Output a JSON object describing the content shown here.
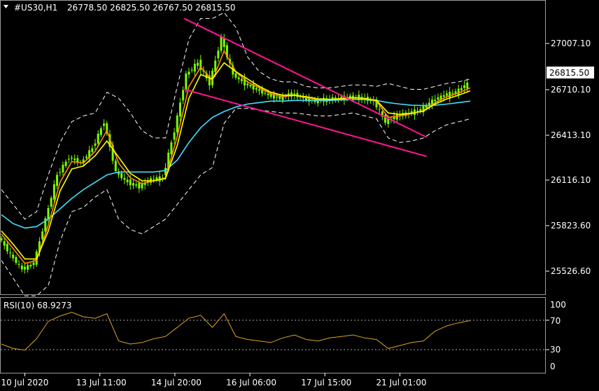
{
  "header": {
    "symbol": "#US30,H1",
    "ohlc": "26778.50 26825.50 26767.50 26815.50"
  },
  "price_axis": {
    "ticks": [
      "27007.10",
      "26710.10",
      "26413.10",
      "26116.10",
      "25823.60",
      "25526.60"
    ],
    "current_price": "26815.50"
  },
  "rsi": {
    "label": "RSI(10) 68.9273",
    "levels": [
      "100",
      "70",
      "30",
      "0"
    ]
  },
  "time_axis": {
    "labels": [
      "10 Jul 2020",
      "13 Jul 11:00",
      "14 Jul 20:00",
      "16 Jul 06:00",
      "17 Jul 15:00",
      "21 Jul 01:00"
    ]
  },
  "colors": {
    "background": "#000000",
    "candles": "#7CFC00",
    "ma_fast": "#FF8C00",
    "ma_mid": "#FFFF00",
    "ma_slow": "#40E0FF",
    "bollinger": "#FFFFFF",
    "trendlines": "#FF1493",
    "rsi_line": "#DAA520",
    "current_price_tag": "#FFFFFF"
  },
  "chart_data": {
    "type": "line",
    "instrument": "#US30",
    "timeframe": "H1",
    "ylim": [
      25400,
      27300
    ],
    "x": [
      0,
      5,
      10,
      15,
      20,
      25,
      30,
      35,
      40,
      45,
      50,
      55,
      60,
      65,
      70,
      75,
      80,
      85,
      90,
      95,
      100,
      105,
      110,
      115,
      120,
      125,
      130,
      135,
      140,
      145,
      150,
      155,
      160,
      165,
      170,
      175,
      180,
      185,
      190,
      195,
      200
    ],
    "x_tick_labels": [
      "10 Jul 2020",
      "13 Jul 11:00",
      "14 Jul 20:00",
      "16 Jul 06:00",
      "17 Jul 15:00",
      "21 Jul 01:00"
    ],
    "x_tick_positions": [
      10,
      42,
      74,
      106,
      138,
      170
    ],
    "price": [
      25780,
      25660,
      25560,
      25600,
      25900,
      26200,
      26320,
      26280,
      26380,
      26560,
      26220,
      26150,
      26120,
      26170,
      26180,
      26500,
      26880,
      26960,
      26820,
      27130,
      26880,
      26820,
      26780,
      26740,
      26720,
      26750,
      26720,
      26700,
      26710,
      26720,
      26730,
      26720,
      26700,
      26560,
      26600,
      26620,
      26640,
      26700,
      26740,
      26760,
      26815
    ],
    "series": [
      {
        "name": "MA fast",
        "values": [
          25800,
          25700,
          25600,
          25620,
          25860,
          26150,
          26290,
          26280,
          26360,
          26500,
          26280,
          26180,
          26140,
          26160,
          26180,
          26460,
          26800,
          26930,
          26840,
          27040,
          26900,
          26830,
          26790,
          26750,
          26730,
          26740,
          26725,
          26710,
          26710,
          26718,
          26725,
          26718,
          26700,
          26590,
          26600,
          26615,
          26635,
          26690,
          26730,
          26755,
          26790
        ]
      },
      {
        "name": "MA mid",
        "values": [
          25820,
          25730,
          25630,
          25630,
          25820,
          26090,
          26240,
          26260,
          26330,
          26430,
          26320,
          26210,
          26160,
          26160,
          26175,
          26400,
          26720,
          26880,
          26850,
          26960,
          26900,
          26850,
          26800,
          26760,
          26740,
          26740,
          26730,
          26715,
          26712,
          26715,
          26722,
          26718,
          26705,
          26620,
          26610,
          26618,
          26632,
          26680,
          26715,
          26740,
          26770
        ]
      },
      {
        "name": "MA slow",
        "values": [
          25930,
          25870,
          25840,
          25850,
          25900,
          25970,
          26040,
          26100,
          26150,
          26200,
          26220,
          26220,
          26220,
          26220,
          26230,
          26300,
          26420,
          26520,
          26590,
          26630,
          26660,
          26680,
          26690,
          26700,
          26700,
          26705,
          26705,
          26705,
          26705,
          26708,
          26710,
          26710,
          26705,
          26690,
          26680,
          26672,
          26670,
          26672,
          26680,
          26690,
          26700
        ]
      },
      {
        "name": "BB upper",
        "values": [
          26100,
          26000,
          25900,
          25950,
          26200,
          26420,
          26560,
          26600,
          26620,
          26760,
          26720,
          26620,
          26500,
          26450,
          26450,
          26800,
          27120,
          27260,
          27260,
          27300,
          27200,
          27000,
          26900,
          26850,
          26830,
          26830,
          26800,
          26790,
          26790,
          26800,
          26810,
          26810,
          26800,
          26820,
          26800,
          26780,
          26780,
          26800,
          26820,
          26830,
          26850
        ]
      },
      {
        "name": "BB lower",
        "values": [
          25620,
          25500,
          25380,
          25380,
          25450,
          25750,
          25950,
          25980,
          26050,
          26100,
          25900,
          25830,
          25800,
          25850,
          25900,
          26000,
          26100,
          26200,
          26250,
          26550,
          26650,
          26650,
          26640,
          26630,
          26620,
          26620,
          26610,
          26600,
          26600,
          26610,
          26620,
          26600,
          26580,
          26450,
          26420,
          26430,
          26450,
          26500,
          26540,
          26560,
          26580
        ]
      },
      {
        "name": "RSI",
        "values": [
          38,
          32,
          30,
          45,
          68,
          75,
          80,
          74,
          72,
          78,
          42,
          38,
          40,
          45,
          48,
          60,
          72,
          76,
          60,
          78,
          48,
          44,
          42,
          40,
          46,
          50,
          44,
          42,
          46,
          48,
          50,
          46,
          44,
          32,
          36,
          40,
          42,
          55,
          62,
          66,
          69
        ]
      }
    ],
    "trendlines": [
      {
        "x": [
          78,
          170
        ],
        "y": [
          27260,
          26470
        ]
      },
      {
        "x": [
          78,
          170
        ],
        "y": [
          26780,
          26340
        ]
      }
    ],
    "rsi_levels": [
      70,
      30
    ]
  }
}
